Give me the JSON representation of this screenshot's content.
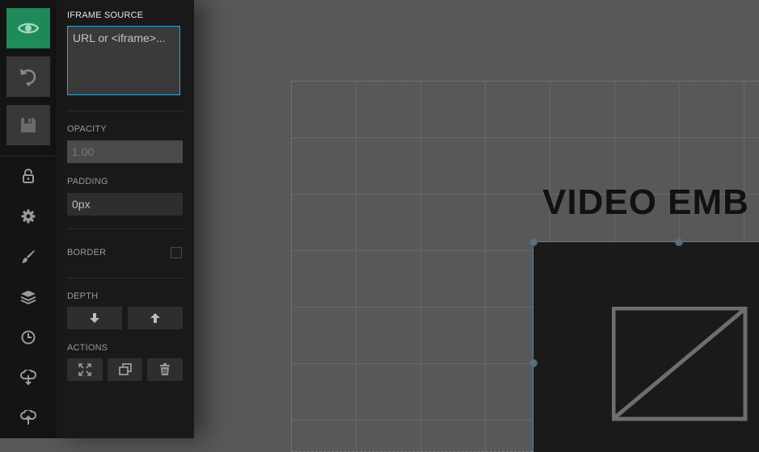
{
  "rail": {
    "buttons": [
      {
        "id": "preview",
        "icon": "eye-icon",
        "color": "#1f8a5a"
      },
      {
        "id": "undo",
        "icon": "undo-icon"
      },
      {
        "id": "save",
        "icon": "floppy-disk-icon"
      }
    ],
    "tools": [
      {
        "id": "lock",
        "icon": "lock-icon"
      },
      {
        "id": "settings",
        "icon": "gear-icon"
      },
      {
        "id": "style",
        "icon": "brush-icon"
      },
      {
        "id": "layers",
        "icon": "layers-icon"
      },
      {
        "id": "history",
        "icon": "clock-icon"
      },
      {
        "id": "cloud-down",
        "icon": "cloud-download-icon"
      },
      {
        "id": "cloud-up",
        "icon": "cloud-upload-icon"
      }
    ]
  },
  "panel": {
    "iframe_source": {
      "label": "IFRAME SOURCE",
      "value": "",
      "placeholder": "URL or <iframe>..."
    },
    "opacity": {
      "label": "OPACITY",
      "value": "1.00"
    },
    "padding": {
      "label": "PADDING",
      "value": "0px"
    },
    "border": {
      "label": "BORDER",
      "checked": false
    },
    "depth": {
      "label": "DEPTH",
      "buttons": [
        "arrow-down-icon",
        "arrow-up-icon"
      ]
    },
    "actions": {
      "label": "ACTIONS",
      "buttons": [
        "expand-icon",
        "duplicate-icon",
        "trash-icon"
      ]
    }
  },
  "canvas": {
    "headline": "VIDEO EMB",
    "accent_color": "#31a3d8"
  }
}
